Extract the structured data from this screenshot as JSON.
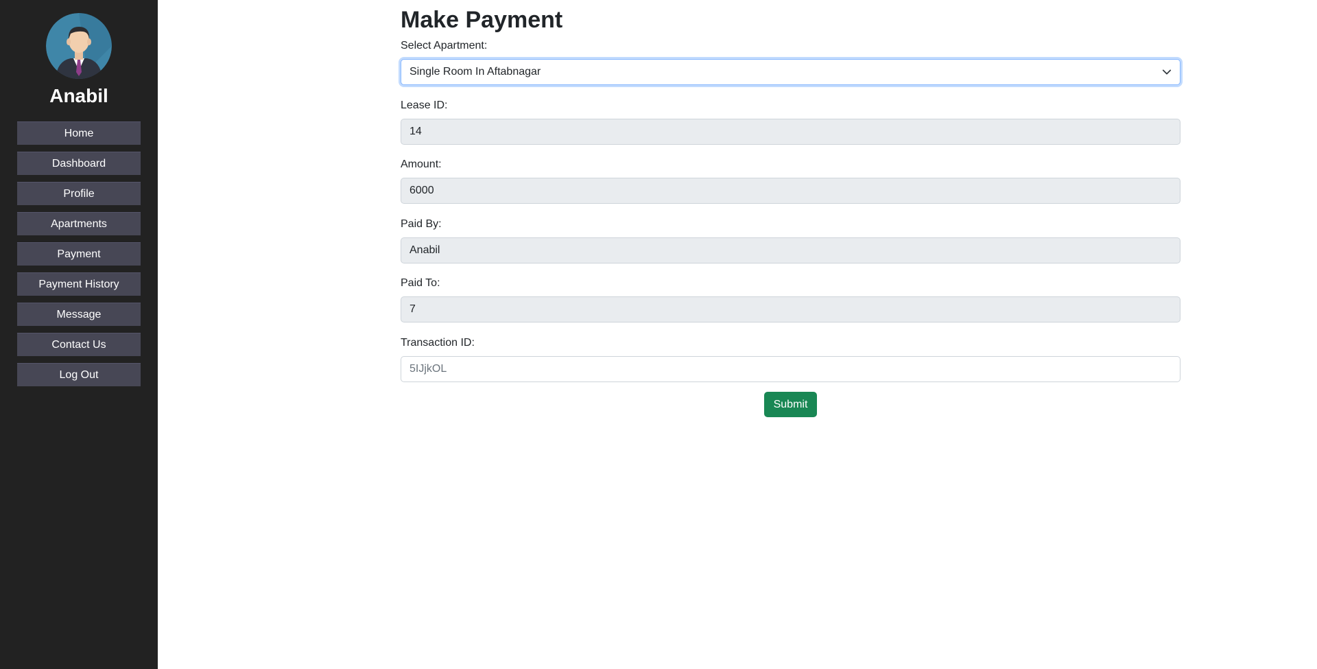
{
  "user": {
    "name": "Anabil"
  },
  "sidebar": {
    "items": [
      {
        "label": "Home"
      },
      {
        "label": "Dashboard"
      },
      {
        "label": "Profile"
      },
      {
        "label": "Apartments"
      },
      {
        "label": "Payment"
      },
      {
        "label": "Payment History"
      },
      {
        "label": "Message"
      },
      {
        "label": "Contact Us"
      },
      {
        "label": "Log Out"
      }
    ]
  },
  "form": {
    "title": "Make Payment",
    "apartment": {
      "label": "Select Apartment:",
      "selected": "Single Room In Aftabnagar"
    },
    "lease_id": {
      "label": "Lease ID:",
      "value": "14"
    },
    "amount": {
      "label": "Amount:",
      "value": "6000"
    },
    "paid_by": {
      "label": "Paid By:",
      "value": "Anabil"
    },
    "paid_to": {
      "label": "Paid To:",
      "value": "7"
    },
    "transaction_id": {
      "label": "Transaction ID:",
      "placeholder": "5IJjkOL"
    },
    "submit_label": "Submit"
  },
  "colors": {
    "sidebar_bg": "#222222",
    "nav_button_bg": "#474755",
    "submit_bg": "#198754",
    "readonly_bg": "#e9ecef",
    "focus_border": "#86b7fe"
  },
  "icons": {
    "avatar": "businessman-avatar-icon",
    "select_arrow": "chevron-down-icon"
  }
}
